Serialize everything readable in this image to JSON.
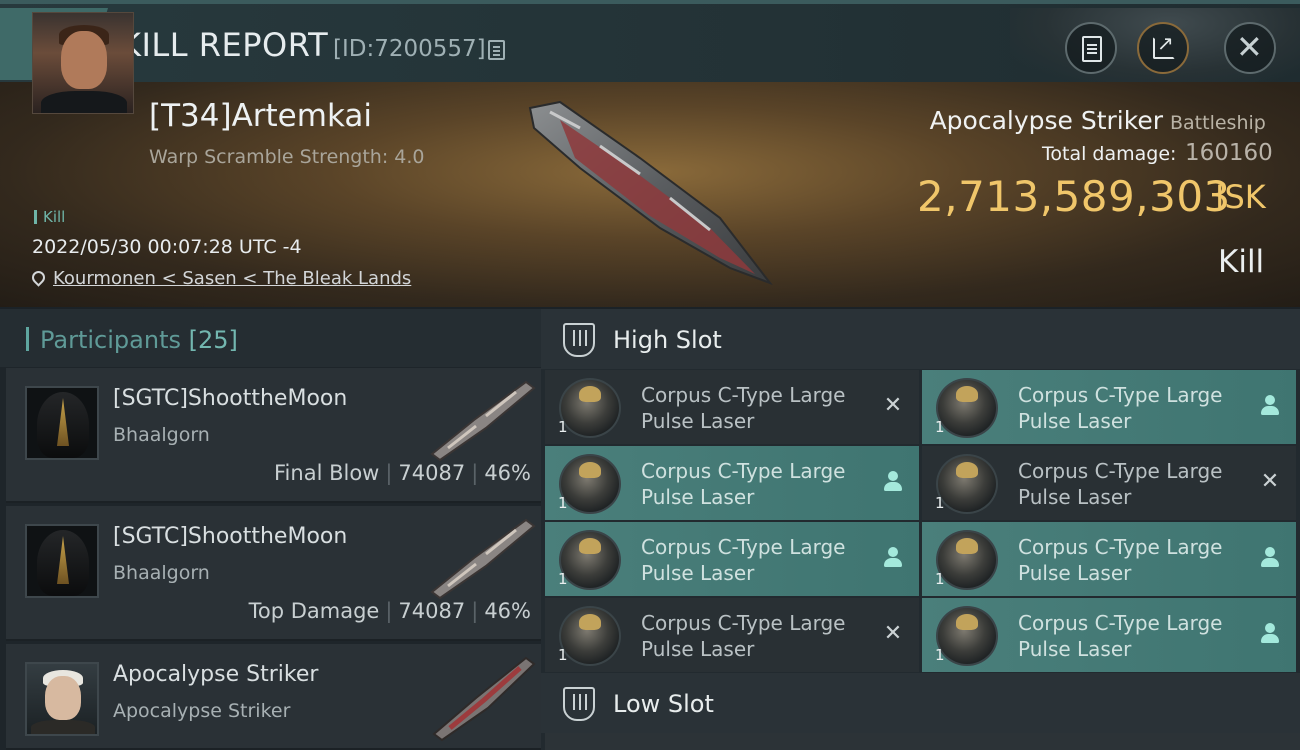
{
  "header": {
    "title": "KILL REPORT",
    "report_id": "[ID:7200557]",
    "icons": [
      "menu-icon",
      "copy-icon",
      "clipboard-icon",
      "share-icon",
      "close-icon"
    ]
  },
  "victim": {
    "name": "[T34]Artemkai",
    "warp_scramble": "Warp Scramble Strength: 4.0",
    "tag": "Kill",
    "timestamp": "2022/05/30 00:07:28 UTC -4",
    "location": "Kourmonen < Sasen < The Bleak Lands",
    "ship_name": "Apocalypse Striker",
    "ship_class": "Battleship",
    "total_damage_label": "Total damage:",
    "total_damage": "160160",
    "isk_value": "2,713,589,303",
    "isk_unit": "ISK",
    "result": "Kill"
  },
  "participants": {
    "label": "Participants",
    "count": "[25]",
    "items": [
      {
        "name": "[SGTC]ShoottheMoon",
        "ship": "Bhaalgorn",
        "role": "Final Blow",
        "damage": "74087",
        "percent": "46%"
      },
      {
        "name": "[SGTC]ShoottheMoon",
        "ship": "Bhaalgorn",
        "role": "Top Damage",
        "damage": "74087",
        "percent": "46%"
      },
      {
        "name": "Apocalypse Striker",
        "ship": "Apocalypse Striker",
        "role": "",
        "damage": "",
        "percent": ""
      }
    ]
  },
  "fitting": {
    "high_slot_label": "High Slot",
    "low_slot_label": "Low Slot",
    "modules": [
      {
        "line1": "Corpus C-Type Large",
        "line2": "Pulse Laser",
        "qty": "1",
        "status": "destroyed"
      },
      {
        "line1": "Corpus C-Type Large",
        "line2": "Pulse Laser",
        "qty": "1",
        "status": "dropped"
      },
      {
        "line1": "Corpus C-Type Large",
        "line2": "Pulse Laser",
        "qty": "1",
        "status": "dropped"
      },
      {
        "line1": "Corpus C-Type Large",
        "line2": "Pulse Laser",
        "qty": "1",
        "status": "destroyed"
      },
      {
        "line1": "Corpus C-Type Large",
        "line2": "Pulse Laser",
        "qty": "1",
        "status": "dropped"
      },
      {
        "line1": "Corpus C-Type Large",
        "line2": "Pulse Laser",
        "qty": "1",
        "status": "dropped"
      },
      {
        "line1": "Corpus C-Type Large",
        "line2": "Pulse Laser",
        "qty": "1",
        "status": "destroyed"
      },
      {
        "line1": "Corpus C-Type Large",
        "line2": "Pulse Laser",
        "qty": "1",
        "status": "dropped"
      }
    ],
    "status_icons": {
      "destroyed": "x-icon",
      "dropped": "user-icon"
    }
  },
  "colors": {
    "accent_teal": "#4a7f7b",
    "isk_gold": "#f0c66a",
    "participants_label": "#5f9a97",
    "kill_tag": "#6fb5a8"
  }
}
